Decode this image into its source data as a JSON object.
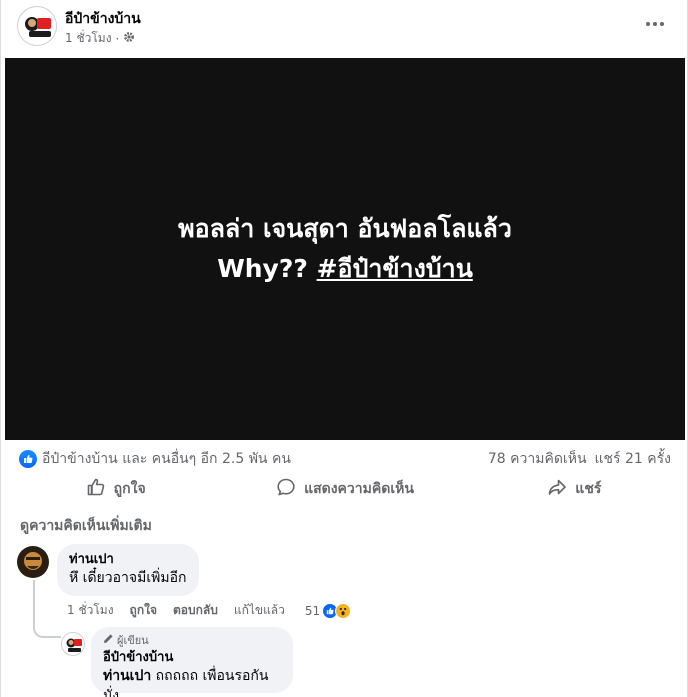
{
  "post": {
    "page_name": "อีป๋าข้างบ้าน",
    "time": "1 ชั่วโมง",
    "privacy_icon": "gear-icon",
    "more_icon": "more-options-icon"
  },
  "media": {
    "line1": "พอลล่า เจนสุดา อันฟอลโลแล้ว",
    "line2_prefix": "Why??",
    "line2_hashtag": "#อีป๋าข้างบ้าน"
  },
  "reactions": {
    "summary": "อีป๋าข้างบ้าน และ คนอื่นๆ อีก 2.5 พัน คน",
    "comments_count": "78 ความคิดเห็น",
    "shares_count": "แชร์ 21 ครั้ง"
  },
  "actions": {
    "like": "ถูกใจ",
    "comment": "แสดงความคิดเห็น",
    "share": "แชร์"
  },
  "more_comments": "ดูความคิดเห็นเพิ่มเติม",
  "comments": [
    {
      "author": "ท่านเปา",
      "text": "หึ เดี๋ยวอาจมีเพิ่มอีก",
      "time": "1 ชั่วโมง",
      "like": "ถูกใจ",
      "reply": "ตอบกลับ",
      "edited": "แก้ไขแล้ว",
      "reaction_count": "51"
    }
  ],
  "reply": {
    "badge": "ผู้เขียน",
    "author": "อีป๋าข้างบ้าน",
    "mention": "ท่านเปา",
    "text": "ถถถถถ เพื่อนรอกันมั่ง"
  },
  "colors": {
    "accent": "#0866ff",
    "secondary_text": "#65676b",
    "bubble": "#f0f2f5",
    "media_bg": "#111111"
  }
}
